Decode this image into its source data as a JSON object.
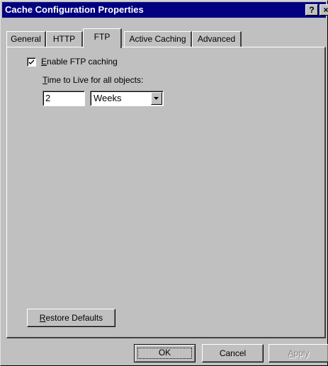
{
  "window": {
    "title": "Cache Configuration Properties",
    "help_glyph": "?",
    "close_glyph": "×"
  },
  "tabs": [
    {
      "label": "General",
      "active": false
    },
    {
      "label": "HTTP",
      "active": false
    },
    {
      "label": "FTP",
      "active": true
    },
    {
      "label": "Active Caching",
      "active": false
    },
    {
      "label": "Advanced",
      "active": false
    }
  ],
  "ftp": {
    "enable_checkbox": {
      "checked": true,
      "label_first": "E",
      "label_rest": "nable FTP caching"
    },
    "ttl_label_first": "T",
    "ttl_label_rest": "ime to Live for all objects:",
    "ttl_value": "2",
    "ttl_unit": "Weeks"
  },
  "buttons": {
    "restore_first": "R",
    "restore_rest": "estore Defaults",
    "ok": "OK",
    "cancel": "Cancel",
    "apply_first": "A",
    "apply_rest": "pply"
  }
}
